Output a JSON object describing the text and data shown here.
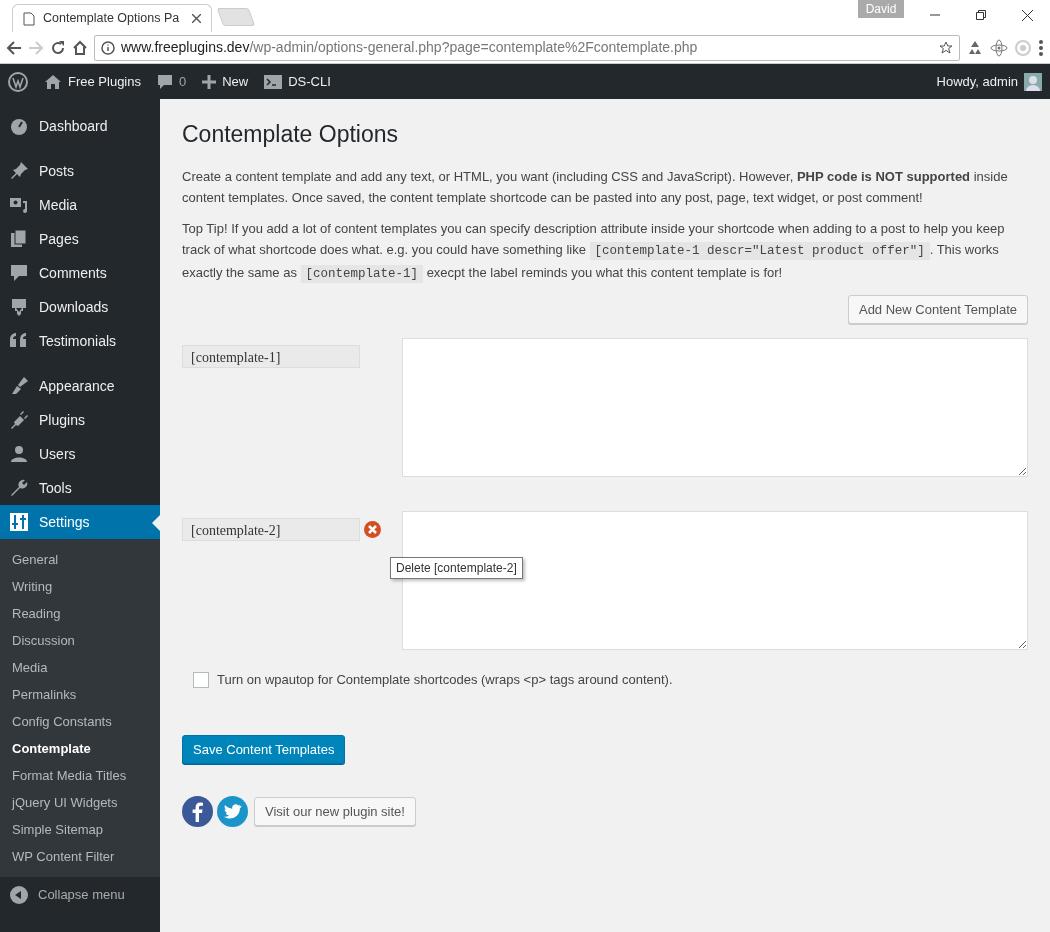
{
  "browser": {
    "tab_title": "Contemplate Options Pa",
    "profile": "David",
    "url_host": "www.freeplugins.dev",
    "url_path": "/wp-admin/options-general.php?page=contemplate%2Fcontemplate.php"
  },
  "admin_bar": {
    "site": "Free Plugins",
    "comments": "0",
    "new": "New",
    "cli": "DS-CLI",
    "greeting": "Howdy, admin"
  },
  "sidebar": {
    "groups": [
      [
        {
          "label": "Dashboard",
          "selected": false
        }
      ],
      [
        {
          "label": "Posts",
          "selected": false
        },
        {
          "label": "Media",
          "selected": false
        },
        {
          "label": "Pages",
          "selected": false
        },
        {
          "label": "Comments",
          "selected": false
        },
        {
          "label": "Downloads",
          "selected": false
        },
        {
          "label": "Testimonials",
          "selected": false
        }
      ],
      [
        {
          "label": "Appearance",
          "selected": false
        },
        {
          "label": "Plugins",
          "selected": false
        },
        {
          "label": "Users",
          "selected": false
        },
        {
          "label": "Tools",
          "selected": false
        },
        {
          "label": "Settings",
          "selected": true,
          "children": [
            {
              "label": "General",
              "selected": false
            },
            {
              "label": "Writing",
              "selected": false
            },
            {
              "label": "Reading",
              "selected": false
            },
            {
              "label": "Discussion",
              "selected": false
            },
            {
              "label": "Media",
              "selected": false
            },
            {
              "label": "Permalinks",
              "selected": false
            },
            {
              "label": "Config Constants",
              "selected": false
            },
            {
              "label": "Contemplate",
              "selected": true
            },
            {
              "label": "Format Media Titles",
              "selected": false
            },
            {
              "label": "jQuery UI Widgets",
              "selected": false
            },
            {
              "label": "Simple Sitemap",
              "selected": false
            },
            {
              "label": "WP Content Filter",
              "selected": false
            }
          ]
        }
      ]
    ],
    "collapse": "Collapse menu"
  },
  "page": {
    "title": "Contemplate Options",
    "paragraphs": [
      [
        {
          "kind": "text",
          "text": "Create a content template and add any text, or HTML, you want (including CSS and JavaScript). However, **PHP code is NOT supported** inside content templates. Once saved, the content template shortcode can be pasted into any post, page, text widget, or post comment!"
        }
      ],
      [
        {
          "kind": "text",
          "text": "Top Tip! If you add a lot of content templates you can specify description attribute inside your shortcode when adding to a post to help you keep track of what shortcode does what. e.g. you could have something like "
        },
        {
          "kind": "code",
          "text": "[contemplate-1 descr=\"Latest product offer\"]"
        },
        {
          "kind": "text",
          "text": ". This works exactly the same as "
        },
        {
          "kind": "code",
          "text": "[contemplate-1]"
        },
        {
          "kind": "text",
          "text": " execpt the label reminds you what this content template is for!"
        }
      ]
    ],
    "add_button": "Add New Content Template",
    "templates": [
      {
        "shortcode": "[contemplate-1]",
        "hovered": false
      },
      {
        "shortcode": "[contemplate-2]",
        "hovered": true,
        "tooltip": "Delete [contemplate-2]"
      }
    ],
    "wpautop": {
      "label": "Turn on wpautop for Contemplate shortcodes (wraps <p> tags around content).",
      "checked": false
    },
    "save_button": "Save Content Templates",
    "visit_button": "Visit our new plugin site!"
  }
}
